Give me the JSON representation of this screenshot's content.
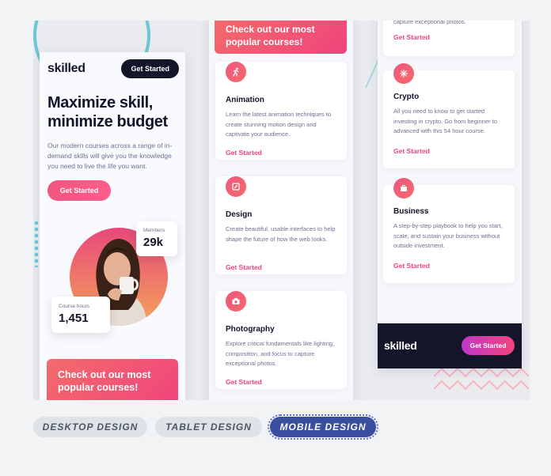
{
  "phone1": {
    "logo": "skilled",
    "nav_button": "Get Started",
    "hero_title": "Maximize skill, minimize budget",
    "hero_text": "Our modern courses across a range of in-demand skills will give you the knowledge you need to live the life you want.",
    "hero_button": "Get Started",
    "members_label": "Members",
    "members_value": "29k",
    "hours_label": "Course hours",
    "hours_value": "1,451",
    "promo": "Check out our most popular courses!"
  },
  "phone2": {
    "promo": "Check out our most popular courses!",
    "cards": [
      {
        "title": "Animation",
        "text": "Learn the latest animation techniques to create stunning motion design and captivate your audience.",
        "link": "Get Started"
      },
      {
        "title": "Design",
        "text": "Create beautiful, usable interfaces to help shape the future of how the web looks.",
        "link": "Get Started"
      },
      {
        "title": "Photography",
        "text": "Explore critical fundamentals like lighting, composition, and focus to capture exceptional photos.",
        "link": "Get Started"
      }
    ]
  },
  "phone3": {
    "top_text": "capture exceptional photos.",
    "top_link": "Get Started",
    "cards": [
      {
        "title": "Crypto",
        "text": "All you need to know to get started investing in crypto. Go from beginner to advanced with this 54 hour course.",
        "link": "Get Started"
      },
      {
        "title": "Business",
        "text": "A step-by-step playbook to help you start, scale, and sustain your business without outside investment.",
        "link": "Get Started"
      }
    ],
    "footer_logo": "skilled",
    "footer_button": "Get Started"
  },
  "tabs": [
    {
      "label": "DESKTOP DESIGN",
      "active": false
    },
    {
      "label": "TABLET DESIGN",
      "active": false
    },
    {
      "label": "MOBILE DESIGN",
      "active": true
    }
  ],
  "colors": {
    "dark": "#14142b",
    "pink": "#f0447c",
    "accent_tab": "#3a4ea0",
    "teal": "#6cc6d4"
  }
}
